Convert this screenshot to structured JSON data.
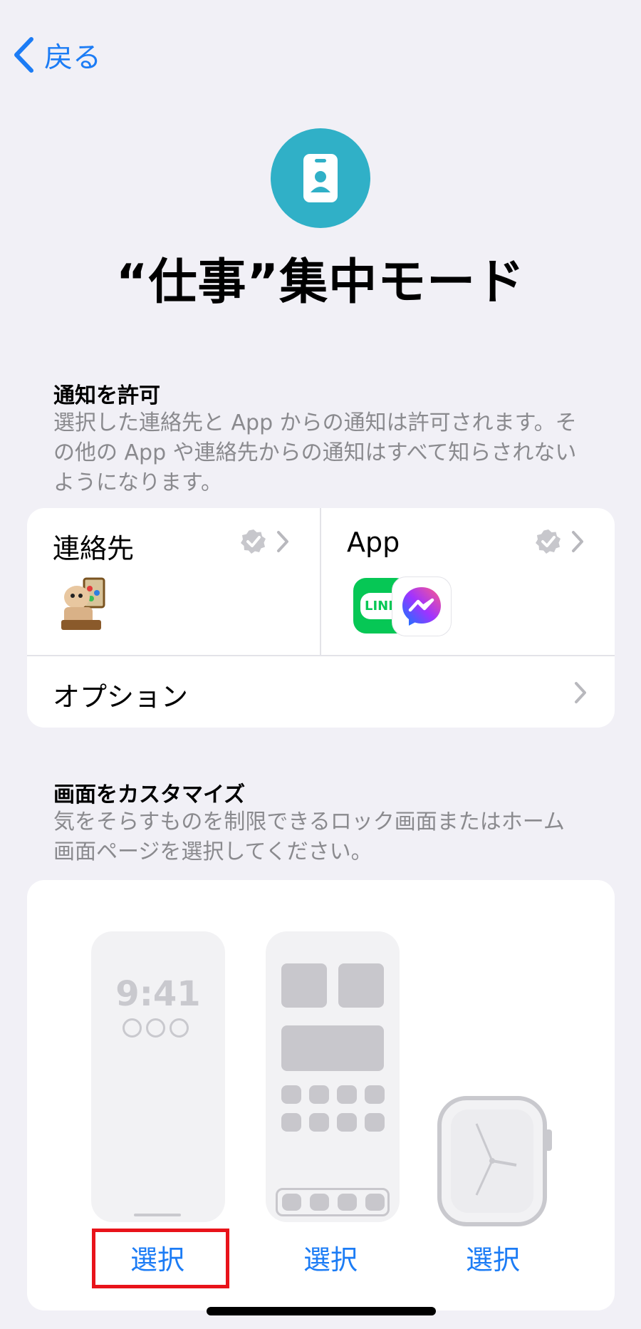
{
  "nav": {
    "back_label": "戻る"
  },
  "header": {
    "title": "“仕事”集中モード",
    "icon": "id-badge-icon"
  },
  "notifications": {
    "title": "通知を許可",
    "description": "選択した連絡先と App からの通知は許可されます。その他の App や連絡先からの通知はすべて知らされないようになります。",
    "contacts_label": "連絡先",
    "apps_label": "App",
    "app_icons": [
      "LINE",
      "Messenger"
    ],
    "options_label": "オプション"
  },
  "customize": {
    "title": "画面をカスタマイズ",
    "description": "気をそらすものを制限できるロック画面またはホーム画面ページを選択してください。",
    "lock_time": "9:41",
    "select_lock": "選択",
    "select_home": "選択",
    "select_watch": "選択"
  },
  "colors": {
    "accent": "#1c7cf5",
    "focus": "#30b0c7",
    "highlight": "#e8131a"
  }
}
